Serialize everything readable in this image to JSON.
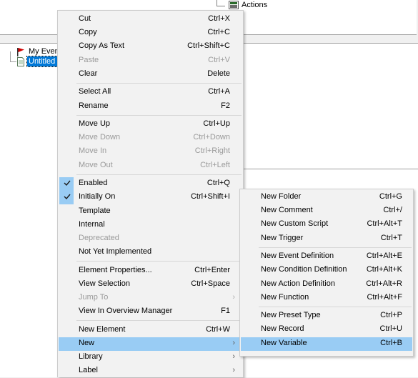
{
  "tree": {
    "top_item": "Actions",
    "items": [
      {
        "label": "My Event",
        "icon": "flag-icon"
      },
      {
        "label": "Untitled T",
        "icon": "document-icon",
        "selected": true
      }
    ]
  },
  "context_menu": {
    "groups": [
      [
        {
          "label": "Cut",
          "shortcut": "Ctrl+X"
        },
        {
          "label": "Copy",
          "shortcut": "Ctrl+C"
        },
        {
          "label": "Copy As Text",
          "shortcut": "Ctrl+Shift+C"
        },
        {
          "label": "Paste",
          "shortcut": "Ctrl+V",
          "disabled": true
        },
        {
          "label": "Clear",
          "shortcut": "Delete"
        }
      ],
      [
        {
          "label": "Select All",
          "shortcut": "Ctrl+A"
        },
        {
          "label": "Rename",
          "shortcut": "F2"
        }
      ],
      [
        {
          "label": "Move Up",
          "shortcut": "Ctrl+Up"
        },
        {
          "label": "Move Down",
          "shortcut": "Ctrl+Down",
          "disabled": true
        },
        {
          "label": "Move In",
          "shortcut": "Ctrl+Right",
          "disabled": true
        },
        {
          "label": "Move Out",
          "shortcut": "Ctrl+Left",
          "disabled": true
        }
      ],
      [
        {
          "label": "Enabled",
          "shortcut": "Ctrl+Q",
          "checked": true
        },
        {
          "label": "Initially On",
          "shortcut": "Ctrl+Shift+I",
          "checked": true
        },
        {
          "label": "Template",
          "shortcut": ""
        },
        {
          "label": "Internal",
          "shortcut": ""
        },
        {
          "label": "Deprecated",
          "shortcut": "",
          "disabled": true
        },
        {
          "label": "Not Yet Implemented",
          "shortcut": ""
        }
      ],
      [
        {
          "label": "Element Properties...",
          "shortcut": "Ctrl+Enter"
        },
        {
          "label": "View Selection",
          "shortcut": "Ctrl+Space"
        },
        {
          "label": "Jump To",
          "shortcut": "",
          "disabled": true,
          "submenu": true
        },
        {
          "label": "View In Overview Manager",
          "shortcut": "F1"
        }
      ],
      [
        {
          "label": "New Element",
          "shortcut": "Ctrl+W"
        },
        {
          "label": "New",
          "shortcut": "",
          "submenu": true,
          "highlighted": true
        },
        {
          "label": "Library",
          "shortcut": "",
          "submenu": true
        },
        {
          "label": "Label",
          "shortcut": "",
          "submenu": true
        }
      ]
    ]
  },
  "submenu": {
    "groups": [
      [
        {
          "label": "New Folder",
          "shortcut": "Ctrl+G"
        },
        {
          "label": "New Comment",
          "shortcut": "Ctrl+/"
        },
        {
          "label": "New Custom Script",
          "shortcut": "Ctrl+Alt+T"
        },
        {
          "label": "New Trigger",
          "shortcut": "Ctrl+T"
        }
      ],
      [
        {
          "label": "New Event Definition",
          "shortcut": "Ctrl+Alt+E"
        },
        {
          "label": "New Condition Definition",
          "shortcut": "Ctrl+Alt+K"
        },
        {
          "label": "New Action Definition",
          "shortcut": "Ctrl+Alt+R"
        },
        {
          "label": "New Function",
          "shortcut": "Ctrl+Alt+F"
        }
      ],
      [
        {
          "label": "New Preset Type",
          "shortcut": "Ctrl+P"
        },
        {
          "label": "New Record",
          "shortcut": "Ctrl+U"
        },
        {
          "label": "New Variable",
          "shortcut": "Ctrl+B",
          "highlighted": true
        }
      ]
    ]
  },
  "colors": {
    "highlight": "#99ccf4",
    "menu_bg": "#f2f2f2",
    "disabled_text": "#9a9a9a",
    "selection": "#0078d7"
  }
}
